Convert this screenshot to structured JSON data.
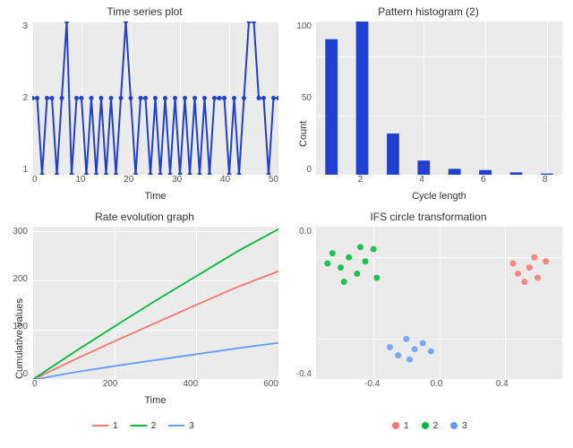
{
  "titles": {
    "ts": "Time series plot",
    "hist": "Pattern histogram (2)",
    "rate": "Rate evolution graph",
    "ifs": "IFS circle transformation"
  },
  "labels": {
    "time": "Time",
    "cycle": "Cycle length",
    "count": "Count",
    "cum": "Cumulative values"
  },
  "legend": {
    "rate": [
      "1",
      "2",
      "3"
    ],
    "ifs": [
      "1",
      "2",
      "3"
    ]
  },
  "colors": {
    "blue": "#2040d0",
    "series": [
      "#f8766d",
      "#00ba38",
      "#619cff"
    ]
  },
  "chart_data": [
    {
      "id": "ts",
      "type": "line",
      "title": "Time series plot",
      "xlabel": "Time",
      "ylabel": "",
      "xlim": [
        0,
        50
      ],
      "ylim": [
        1,
        3
      ],
      "x_ticks": [
        0,
        10,
        20,
        30,
        40,
        50
      ],
      "y_ticks": [
        1,
        2,
        3
      ],
      "x": [
        0,
        1,
        2,
        3,
        4,
        5,
        6,
        7,
        8,
        9,
        10,
        11,
        12,
        13,
        14,
        15,
        16,
        17,
        18,
        19,
        20,
        21,
        22,
        23,
        24,
        25,
        26,
        27,
        28,
        29,
        30,
        31,
        32,
        33,
        34,
        35,
        36,
        37,
        38,
        39,
        40,
        41,
        42,
        43,
        44,
        45,
        46,
        47,
        48,
        49,
        50
      ],
      "y": [
        2,
        2,
        1,
        2,
        2,
        1,
        2,
        3,
        1,
        2,
        2,
        1,
        2,
        1,
        2,
        1,
        2,
        1,
        2,
        3,
        2,
        1,
        2,
        2,
        1,
        2,
        1,
        2,
        1,
        2,
        1,
        2,
        1,
        2,
        1,
        2,
        1,
        2,
        2,
        2,
        1,
        2,
        1,
        2,
        3,
        3,
        2,
        2,
        1,
        2,
        2
      ]
    },
    {
      "id": "hist",
      "type": "bar",
      "title": "Pattern histogram (2)",
      "xlabel": "Cycle length",
      "ylabel": "Count",
      "xlim": [
        0.5,
        8.5
      ],
      "ylim": [
        0,
        130
      ],
      "x_ticks": [
        2,
        4,
        6,
        8
      ],
      "y_ticks": [
        0,
        50,
        100
      ],
      "categories": [
        1,
        2,
        3,
        4,
        5,
        6,
        7,
        8
      ],
      "values": [
        115,
        130,
        35,
        12,
        5,
        4,
        2,
        1
      ]
    },
    {
      "id": "rate",
      "type": "line",
      "title": "Rate evolution graph",
      "xlabel": "Time",
      "ylabel": "Cumulative values",
      "xlim": [
        0,
        600
      ],
      "ylim": [
        0,
        310
      ],
      "x_ticks": [
        0,
        200,
        400,
        600
      ],
      "y_ticks": [
        0,
        100,
        200,
        300
      ],
      "series": [
        {
          "name": "1",
          "color": "#f8766d",
          "x": [
            0,
            100,
            200,
            300,
            400,
            500,
            600
          ],
          "y": [
            0,
            40,
            78,
            115,
            152,
            188,
            220
          ]
        },
        {
          "name": "2",
          "color": "#00ba38",
          "x": [
            0,
            100,
            200,
            300,
            400,
            500,
            600
          ],
          "y": [
            0,
            55,
            108,
            160,
            210,
            260,
            305
          ]
        },
        {
          "name": "3",
          "color": "#619cff",
          "x": [
            0,
            100,
            200,
            300,
            400,
            500,
            600
          ],
          "y": [
            0,
            15,
            28,
            40,
            52,
            64,
            75
          ]
        }
      ]
    },
    {
      "id": "ifs",
      "type": "scatter",
      "title": "IFS circle transformation",
      "xlabel": "",
      "ylabel": "",
      "xlim": [
        -0.75,
        0.75
      ],
      "ylim": [
        -0.6,
        0.15
      ],
      "x_ticks": [
        -0.4,
        0.0,
        0.4
      ],
      "y_ticks": [
        -0.4,
        0.0
      ],
      "series": [
        {
          "name": "1",
          "color": "#f8766d",
          "points": [
            [
              0.45,
              -0.03
            ],
            [
              0.48,
              -0.08
            ],
            [
              0.55,
              -0.05
            ],
            [
              0.6,
              -0.1
            ],
            [
              0.65,
              -0.02
            ],
            [
              0.52,
              -0.12
            ],
            [
              0.58,
              0.0
            ]
          ]
        },
        {
          "name": "2",
          "color": "#00ba38",
          "points": [
            [
              -0.65,
              0.02
            ],
            [
              -0.6,
              -0.05
            ],
            [
              -0.55,
              0.0
            ],
            [
              -0.5,
              -0.08
            ],
            [
              -0.45,
              -0.02
            ],
            [
              -0.4,
              0.04
            ],
            [
              -0.38,
              -0.1
            ],
            [
              -0.58,
              -0.12
            ],
            [
              -0.68,
              -0.03
            ],
            [
              -0.48,
              0.05
            ]
          ]
        },
        {
          "name": "3",
          "color": "#619cff",
          "points": [
            [
              -0.2,
              -0.4
            ],
            [
              -0.15,
              -0.45
            ],
            [
              -0.1,
              -0.42
            ],
            [
              -0.25,
              -0.48
            ],
            [
              -0.05,
              -0.46
            ],
            [
              -0.3,
              -0.44
            ],
            [
              -0.18,
              -0.5
            ]
          ]
        }
      ]
    }
  ]
}
